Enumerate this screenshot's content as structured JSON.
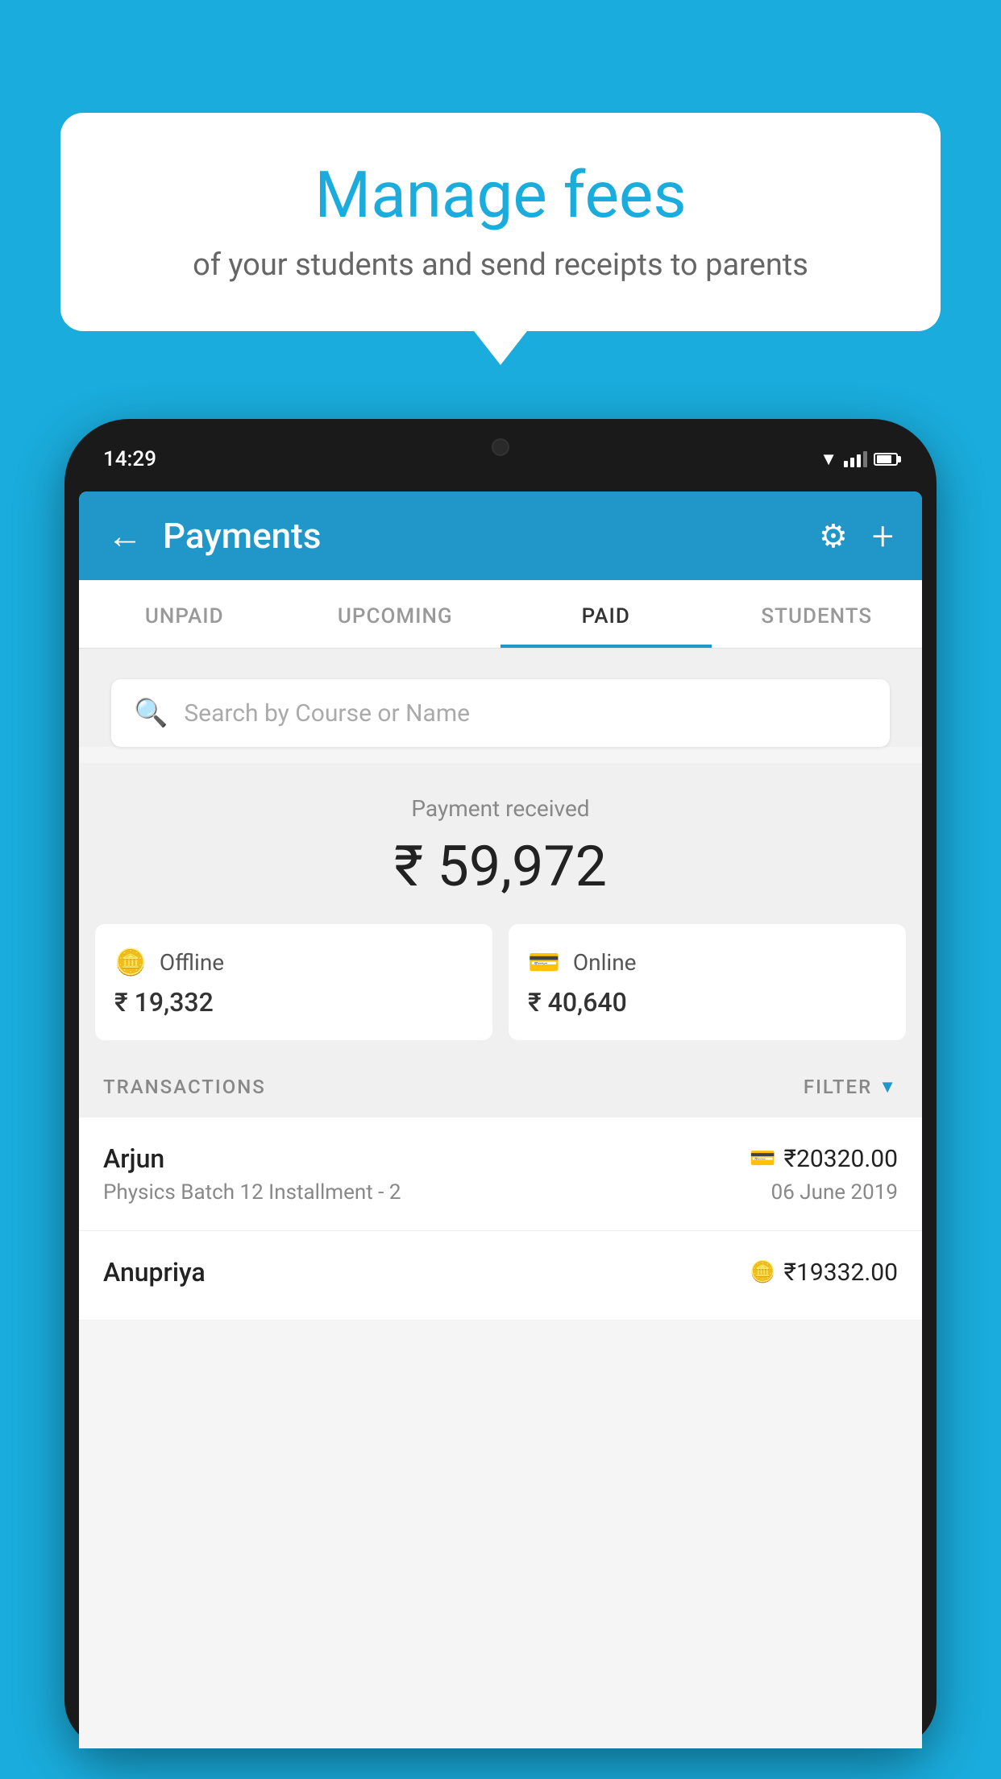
{
  "background_color": "#1AACDC",
  "bubble": {
    "title": "Manage fees",
    "subtitle": "of your students and send receipts to parents"
  },
  "phone": {
    "status_bar": {
      "time": "14:29"
    },
    "header": {
      "back_label": "←",
      "title": "Payments",
      "gear_label": "⚙",
      "plus_label": "+"
    },
    "tabs": [
      {
        "label": "UNPAID",
        "active": false
      },
      {
        "label": "UPCOMING",
        "active": false
      },
      {
        "label": "PAID",
        "active": true
      },
      {
        "label": "STUDENTS",
        "active": false
      }
    ],
    "search": {
      "placeholder": "Search by Course or Name"
    },
    "payment_summary": {
      "label": "Payment received",
      "amount": "₹ 59,972",
      "offline_label": "Offline",
      "offline_amount": "₹ 19,332",
      "online_label": "Online",
      "online_amount": "₹ 40,640"
    },
    "transactions": {
      "section_label": "TRANSACTIONS",
      "filter_label": "FILTER",
      "rows": [
        {
          "name": "Arjun",
          "amount": "₹20320.00",
          "course": "Physics Batch 12 Installment - 2",
          "date": "06 June 2019",
          "method": "online"
        },
        {
          "name": "Anupriya",
          "amount": "₹19332.00",
          "course": "",
          "date": "",
          "method": "offline"
        }
      ]
    }
  }
}
